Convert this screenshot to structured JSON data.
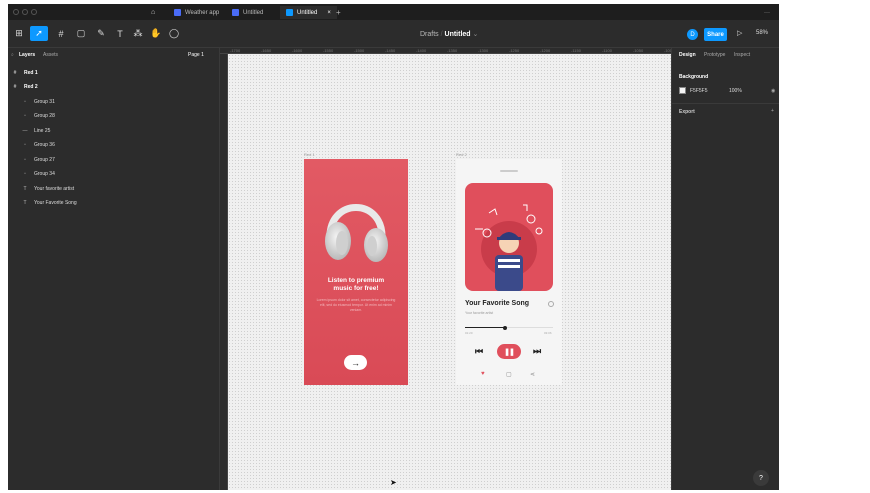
{
  "tabs": [
    {
      "label": "Weather app"
    },
    {
      "label": "Untitled"
    },
    {
      "label": "Untitled"
    }
  ],
  "toolbar": {
    "breadcrumb_parent": "Drafts",
    "file_name": "Untitled",
    "user_initial": "D",
    "share_label": "Share",
    "zoom": "58%"
  },
  "left_panel": {
    "tab_layers": "Layers",
    "tab_assets": "Assets",
    "page_label": "Page 1",
    "layers": [
      {
        "label": "Red 1",
        "kind": "frame"
      },
      {
        "label": "Red 2",
        "kind": "frame"
      },
      {
        "label": "Group 31",
        "kind": "group"
      },
      {
        "label": "Group 28",
        "kind": "group"
      },
      {
        "label": "Line 25",
        "kind": "line"
      },
      {
        "label": "Group 36",
        "kind": "group"
      },
      {
        "label": "Group 27",
        "kind": "group"
      },
      {
        "label": "Group 34",
        "kind": "group"
      },
      {
        "label": "Your favorite artist",
        "kind": "text"
      },
      {
        "label": "Your Favorite Song",
        "kind": "text"
      }
    ]
  },
  "right_panel": {
    "tab_design": "Design",
    "tab_prototype": "Prototype",
    "tab_inspect": "Inspect",
    "background_heading": "Background",
    "background_hex": "F5F5F5",
    "background_opacity": "100%",
    "export_heading": "Export"
  },
  "ruler": [
    "-1700",
    "-1650",
    "-1600",
    "-1550",
    "-1500",
    "-1450",
    "-1400",
    "-1350",
    "-1300",
    "-1250",
    "-1200",
    "-1150",
    "-1100",
    "-1050",
    "-1000"
  ],
  "canvas": {
    "frame1_label": "Red 1",
    "frame2_label": "Red 2"
  },
  "frame1": {
    "title_line1": "Listen to premium",
    "title_line2": "music for free!",
    "body": "Lorem ipsum dolor sit amet, consectetur adipiscing elit, sed do eiusmod tempor. Ut enim ad minim veniam.",
    "button_glyph": "→"
  },
  "frame2": {
    "song_title": "Your Favorite Song",
    "artist": "Your favorite artist",
    "time_elapsed": "01:20",
    "time_total": "03:06",
    "progress": 0.45
  },
  "colors": {
    "accent": "#0d99ff",
    "brand_red": "#e04f5c",
    "panel_bg": "#2c2c2c"
  },
  "help_label": "?"
}
